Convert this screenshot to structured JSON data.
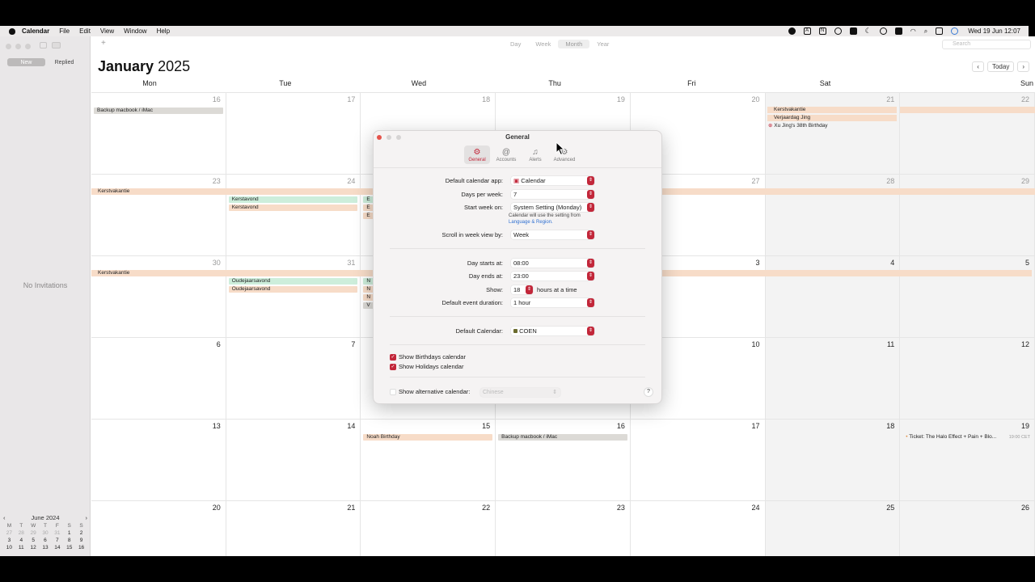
{
  "menubar": {
    "app": "Calendar",
    "items": [
      "File",
      "Edit",
      "View",
      "Window",
      "Help"
    ],
    "clock": "Wed 19 Jun 12:07",
    "status_letter_a": "A",
    "status_letter_n": "N"
  },
  "sidebar": {
    "segments": [
      "New",
      "Replied"
    ],
    "selected_segment": "New",
    "empty_text": "No Invitations",
    "mini_calendar": {
      "month": "June 2024",
      "weekdays": [
        "M",
        "T",
        "W",
        "T",
        "F",
        "S",
        "S"
      ],
      "days": [
        [
          "27",
          "28",
          "29",
          "30",
          "31",
          "1",
          "2"
        ],
        [
          "3",
          "4",
          "5",
          "6",
          "7",
          "8",
          "9"
        ],
        [
          "10",
          "11",
          "12",
          "13",
          "14",
          "15",
          "16"
        ]
      ]
    }
  },
  "toolbar": {
    "add": "+",
    "views": [
      "Day",
      "Week",
      "Month",
      "Year"
    ],
    "selected_view": "Month",
    "search_placeholder": "Search",
    "today": "Today"
  },
  "calendar": {
    "month": "January",
    "year": "2025",
    "weekdays": [
      "Mon",
      "Tue",
      "Wed",
      "Thu",
      "Fri",
      "Sat",
      "Sun"
    ],
    "weeks": [
      [
        "16",
        "17",
        "18",
        "19",
        "20",
        "21",
        "22"
      ],
      [
        "23",
        "24",
        "25",
        "26",
        "27",
        "28",
        "29"
      ],
      [
        "30",
        "31",
        "1",
        "2",
        "3",
        "4",
        "5"
      ],
      [
        "6",
        "7",
        "8",
        "9",
        "10",
        "11",
        "12"
      ],
      [
        "13",
        "14",
        "15",
        "16",
        "17",
        "18",
        "19"
      ],
      [
        "20",
        "21",
        "22",
        "23",
        "24",
        "25",
        "26"
      ]
    ],
    "events": {
      "backup1": "Backup macbook / iMac",
      "kerstvakantie": "Kerstvakantie",
      "verjaardag": "Verjaardag Jing",
      "birthday_xu": "Xu Jing's 38th Birthday",
      "kerstavond1": "Kerstavond",
      "kerstavond2": "Kerstavond",
      "oudejaars1": "Oudejaarsavond",
      "oudejaars2": "Oudejaarsavond",
      "noah": "Noah Birthday",
      "backup2": "Backup macbook / iMac",
      "ticket": "Ticket: The Halo Effect + Pain + Blo...",
      "ticket_time": "19:00 CET",
      "frag_e": "E",
      "frag_n": "N",
      "frag_v": "V"
    }
  },
  "dialog": {
    "title": "General",
    "tabs": [
      {
        "label": "General",
        "icon": "gear-icon"
      },
      {
        "label": "Accounts",
        "icon": "at-icon"
      },
      {
        "label": "Alerts",
        "icon": "bell-icon"
      },
      {
        "label": "Advanced",
        "icon": "gears-icon"
      }
    ],
    "selected_tab": "General",
    "default_app_label": "Default calendar app:",
    "default_app_value": "Calendar",
    "days_per_week_label": "Days per week:",
    "days_per_week_value": "7",
    "start_week_label": "Start week on:",
    "start_week_value": "System Setting (Monday)",
    "start_week_note": "Calendar will use the setting from",
    "start_week_link": "Language & Region.",
    "scroll_label": "Scroll in week view by:",
    "scroll_value": "Week",
    "day_starts_label": "Day starts at:",
    "day_starts_value": "08:00",
    "day_ends_label": "Day ends at:",
    "day_ends_value": "23:00",
    "show_label": "Show:",
    "show_value": "18",
    "show_suffix": "hours at a time",
    "duration_label": "Default event duration:",
    "duration_value": "1 hour",
    "default_calendar_label": "Default Calendar:",
    "default_calendar_value": "COEN",
    "show_birthdays": "Show Birthdays calendar",
    "show_holidays": "Show Holidays calendar",
    "show_alt": "Show alternative calendar:",
    "alt_value": "Chinese",
    "help": "?"
  },
  "colors": {
    "accent": "#c2273a",
    "event_orange": "#f7dcc8",
    "event_green": "#cdeedb",
    "event_gray": "#dcdad6"
  }
}
